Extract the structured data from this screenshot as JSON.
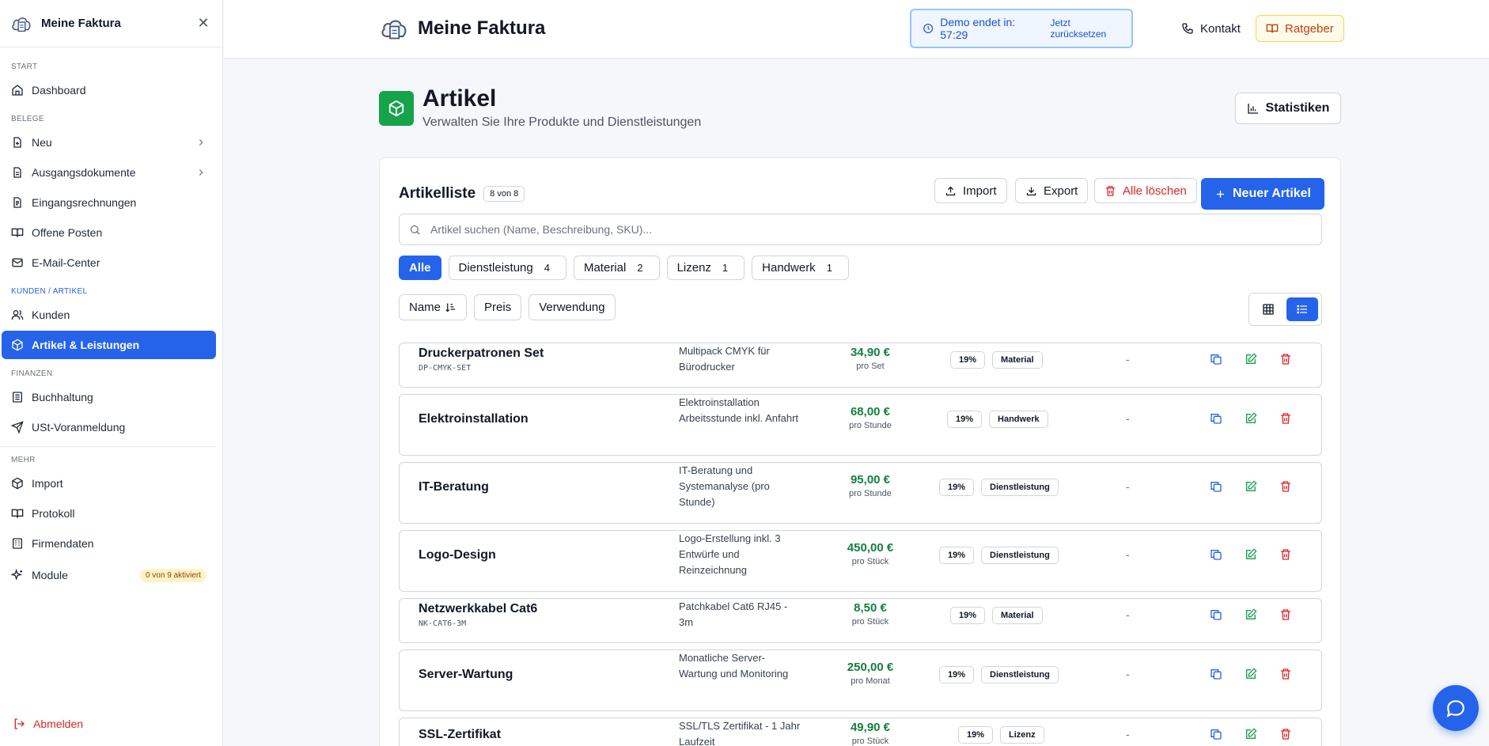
{
  "app": {
    "name": "Meine Faktura"
  },
  "sidebar": {
    "sections": {
      "start": "START",
      "belege": "BELEGE",
      "kunden": "KUNDEN / ARTIKEL",
      "finanzen": "FINANZEN",
      "mehr": "MEHR"
    },
    "items": {
      "dashboard": "Dashboard",
      "neu": "Neu",
      "ausgang": "Ausgangsdokumente",
      "eingang": "Eingangsrechnungen",
      "offene": "Offene Posten",
      "email": "E-Mail-Center",
      "kunden": "Kunden",
      "artikel": "Artikel & Leistungen",
      "buchhaltung": "Buchhaltung",
      "ust": "USt-Voranmeldung",
      "import": "Import",
      "protokoll": "Protokoll",
      "firmendaten": "Firmendaten",
      "module": "Module",
      "module_badge": "0 von 9 aktiviert",
      "logout": "Abmelden"
    }
  },
  "topbar": {
    "demo_text": "Demo endet in: 57:29",
    "reset": "Jetzt zurücksetzen",
    "contact": "Kontakt",
    "ratgeber": "Ratgeber"
  },
  "page": {
    "title": "Artikel",
    "subtitle": "Verwalten Sie Ihre Produkte und Dienstleistungen",
    "stats": "Statistiken"
  },
  "list": {
    "title": "Artikelliste",
    "count": "8 von 8",
    "import": "Import",
    "export": "Export",
    "delete_all": "Alle löschen",
    "new": "Neuer Artikel",
    "search_placeholder": "Artikel suchen (Name, Beschreibung, SKU)...",
    "filters": [
      {
        "label": "Alle",
        "count": ""
      },
      {
        "label": "Dienstleistung",
        "count": "4"
      },
      {
        "label": "Material",
        "count": "2"
      },
      {
        "label": "Lizenz",
        "count": "1"
      },
      {
        "label": "Handwerk",
        "count": "1"
      }
    ],
    "sorts": {
      "name": "Name",
      "price": "Preis",
      "usage": "Verwendung"
    }
  },
  "articles": [
    {
      "name": "Druckerpatronen Set",
      "sku": "DP-CMYK-SET",
      "desc": "Multipack CMYK für Bürodrucker",
      "price": "34,90 €",
      "unit": "pro Set",
      "tax": "19%",
      "category": "Material",
      "usage": "-"
    },
    {
      "name": "Elektroinstallation",
      "sku": "",
      "desc": "Elektroinstallation Arbeitsstunde inkl. Anfahrt",
      "price": "68,00 €",
      "unit": "pro Stunde",
      "tax": "19%",
      "category": "Handwerk",
      "usage": "-"
    },
    {
      "name": "IT-Beratung",
      "sku": "",
      "desc": "IT-Beratung und Systemanalyse (pro Stunde)",
      "price": "95,00 €",
      "unit": "pro Stunde",
      "tax": "19%",
      "category": "Dienstleistung",
      "usage": "-"
    },
    {
      "name": "Logo-Design",
      "sku": "",
      "desc": "Logo-Erstellung inkl. 3 Entwürfe und Reinzeichnung",
      "price": "450,00 €",
      "unit": "pro Stück",
      "tax": "19%",
      "category": "Dienstleistung",
      "usage": "-"
    },
    {
      "name": "Netzwerkkabel Cat6",
      "sku": "NK-CAT6-3M",
      "desc": "Patchkabel Cat6 RJ45 - 3m",
      "price": "8,50 €",
      "unit": "pro Stück",
      "tax": "19%",
      "category": "Material",
      "usage": "-"
    },
    {
      "name": "Server-Wartung",
      "sku": "",
      "desc": "Monatliche Server-Wartung und Monitoring",
      "price": "250,00 €",
      "unit": "pro Monat",
      "tax": "19%",
      "category": "Dienstleistung",
      "usage": "-"
    },
    {
      "name": "SSL-Zertifikat",
      "sku": "",
      "desc": "SSL/TLS Zertifikat - 1 Jahr Laufzeit",
      "price": "49,90 €",
      "unit": "pro Stück",
      "tax": "19%",
      "category": "Lizenz",
      "usage": "-"
    }
  ],
  "colors": {
    "primary": "#2563eb",
    "success": "#16a34a",
    "danger": "#dc2626",
    "price": "#15803d"
  }
}
